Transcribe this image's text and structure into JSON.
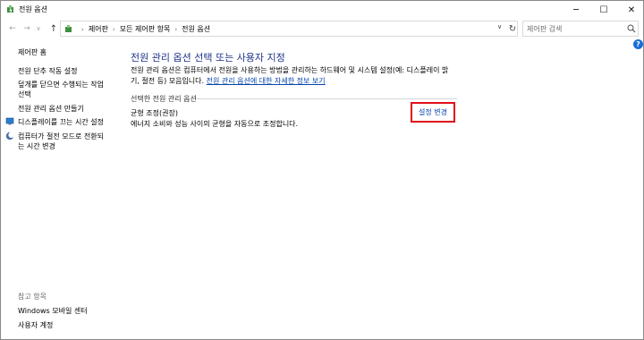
{
  "window": {
    "title": "전원 옵션",
    "controls": {
      "minimize": "─",
      "maximize": "☐",
      "close": "✕"
    }
  },
  "toolbar": {
    "back": "←",
    "forward": "→",
    "recent": "∨",
    "up": "↑",
    "breadcrumbs": [
      "제어판",
      "모든 제어판 항목",
      "전원 옵션"
    ],
    "separator": "›",
    "dropdown": "∨",
    "refresh": "↻",
    "search_placeholder": "제어판 검색"
  },
  "help": {
    "label": "?"
  },
  "sidebar": {
    "home": "제어판 홈",
    "links": [
      "전원 단추 작동 설정",
      "덮개를 닫으면 수행되는 작업",
      "선택",
      "전원 관리 옵션 만들기",
      "디스플레이를 끄는 시간 설정",
      "컴퓨터가 절전 모드로 전환되",
      "는 시간 변경"
    ],
    "see_also_title": "참고 항목",
    "see_also": [
      "Windows 모바일 센터",
      "사용자 계정"
    ]
  },
  "main": {
    "title": "전원 관리 옵션 선택 또는 사용자 지정",
    "description_line1": "전원 관리 옵션은 컴퓨터에서 전원을 사용하는 방법을 관리하는 하드웨어 및 시스템 설정(예: 디스플레이 밝",
    "description_line2_prefix": "기, 절전 등) 모음입니다. ",
    "description_link": "전원 관리 옵션에 대한 자세한 정보 보기",
    "section_label": "선택한 전원 관리 옵션",
    "plan_name": "균형 조정(권장)",
    "plan_description": "에너지 소비와 성능 사이의 균형을 자동으로 조정합니다.",
    "change_settings": "설정 변경"
  },
  "colors": {
    "title_blue": "#1e3287",
    "link_blue": "#0645ad",
    "highlight_red": "#e0101b",
    "help_blue": "#1a6dd6"
  }
}
